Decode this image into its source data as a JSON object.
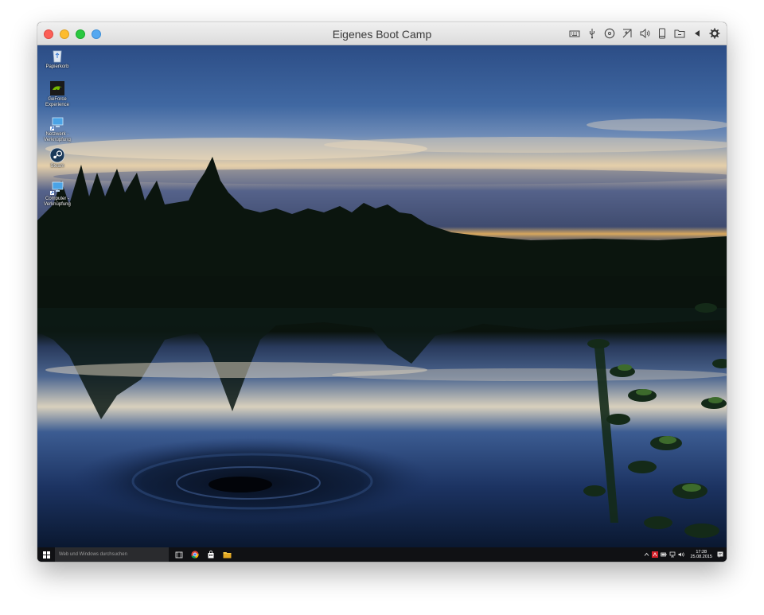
{
  "window": {
    "title": "Eigenes Boot Camp",
    "toolbar_icons": [
      "keyboard-icon",
      "usb-icon",
      "cd-icon",
      "network-icon",
      "audio-icon",
      "phone-icon",
      "folder-icon",
      "back-arrow-icon",
      "gear-icon"
    ]
  },
  "desktop": {
    "icons": [
      {
        "label": "Papierkorb",
        "icon": "recycle-bin-icon"
      },
      {
        "label": "GeForce Experience",
        "icon": "geforce-icon"
      },
      {
        "label": "Netzwerk - Verknüpfung",
        "icon": "network-shortcut-icon"
      },
      {
        "label": "Steam",
        "icon": "steam-icon"
      },
      {
        "label": "Computer - Verknüpfung",
        "icon": "computer-shortcut-icon"
      }
    ]
  },
  "taskbar": {
    "search_placeholder": "Web und Windows durchsuchen",
    "apps": [
      "task-view-icon",
      "chrome-icon",
      "store-icon",
      "explorer-icon"
    ],
    "tray_icons": [
      "chevron-up-icon",
      "acrobat-icon",
      "battery-icon",
      "network-tray-icon",
      "volume-icon",
      "notification-icon"
    ],
    "time": "17:28",
    "date": "25.08.2015"
  },
  "colors": {
    "close": "#fc5f57",
    "minimize": "#fdbc2e",
    "zoom": "#29c840",
    "fullscreen": "#54a8f0",
    "taskbar": "#101114"
  }
}
